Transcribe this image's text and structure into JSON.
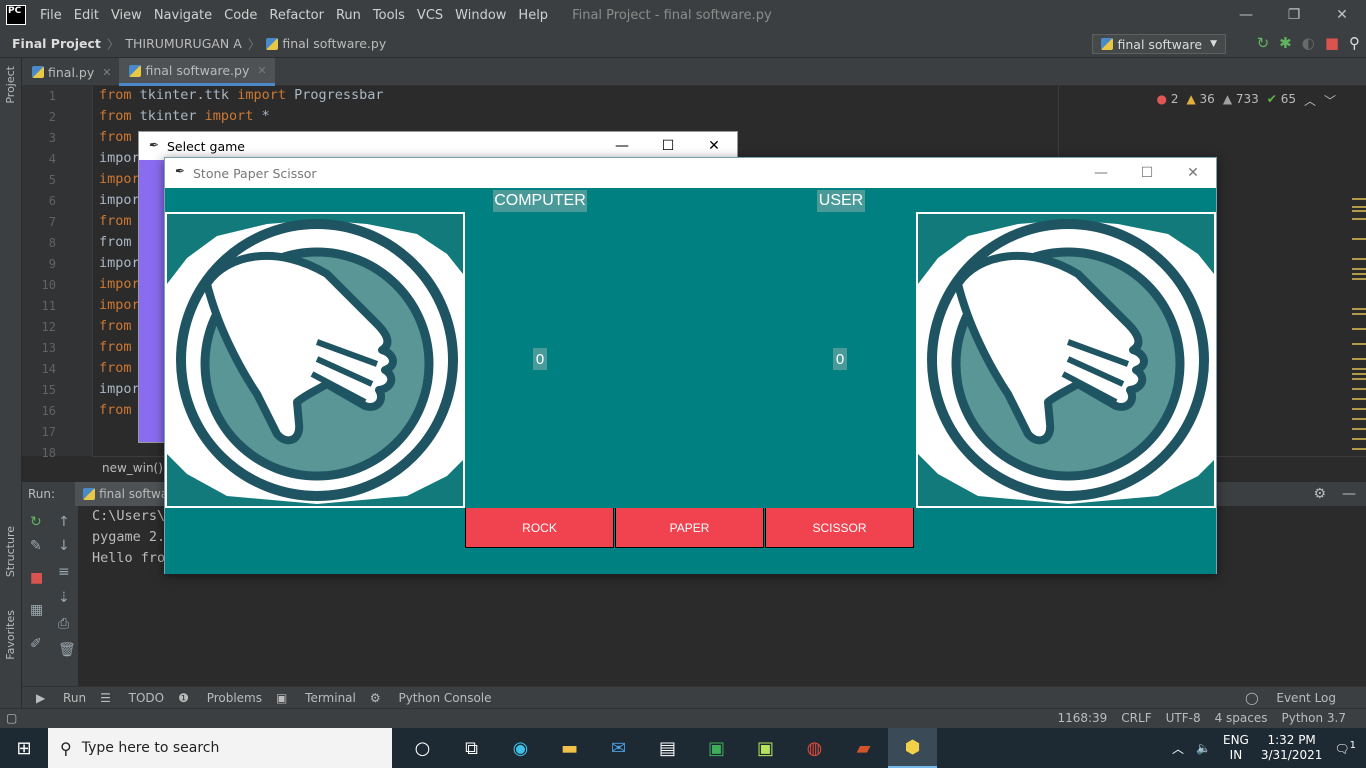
{
  "ide": {
    "logo": "PC",
    "menu": [
      "File",
      "Edit",
      "View",
      "Navigate",
      "Code",
      "Refactor",
      "Run",
      "Tools",
      "VCS",
      "Window",
      "Help"
    ],
    "window_title": "Final Project - final software.py",
    "breadcrumb": [
      "Final Project",
      "THIRUMURUGAN A",
      "final software.py"
    ],
    "run_config": "final software",
    "tabs": [
      {
        "label": "final.py",
        "active": false
      },
      {
        "label": "final software.py",
        "active": true
      }
    ],
    "side_labels": {
      "project": "Project",
      "structure": "Structure",
      "favorites": "Favorites"
    },
    "line_numbers": [
      "1",
      "2",
      "3",
      "4",
      "5",
      "6",
      "7",
      "8",
      "9",
      "10",
      "11",
      "12",
      "13",
      "14",
      "15",
      "16",
      "17",
      "18"
    ],
    "code_lines": [
      {
        "kw": "from",
        "rest": " tkinter.ttk ",
        "kw2": "import",
        "rest2": " Progressbar"
      },
      {
        "kw": "from",
        "rest": " tkinter ",
        "kw2": "import",
        "rest2": " *"
      },
      {
        "kw": "from",
        "rest": "",
        "kw2": "",
        "rest2": ""
      },
      {
        "kw": "",
        "rest": "impor",
        "kw2": "",
        "rest2": ""
      },
      {
        "kw": "impor",
        "rest": "",
        "kw2": "",
        "rest2": ""
      },
      {
        "kw": "",
        "rest": "impor",
        "kw2": "",
        "rest2": ""
      },
      {
        "kw": "from",
        "rest": "",
        "kw2": "",
        "rest2": ""
      },
      {
        "kw": "",
        "rest": "from",
        "kw2": "",
        "rest2": ""
      },
      {
        "kw": "",
        "rest": "impor",
        "kw2": "",
        "rest2": ""
      },
      {
        "kw": "impor",
        "rest": "",
        "kw2": "",
        "rest2": ""
      },
      {
        "kw": "impor",
        "rest": "",
        "kw2": "",
        "rest2": ""
      },
      {
        "kw": "from",
        "rest": "",
        "kw2": "",
        "rest2": ""
      },
      {
        "kw": "from",
        "rest": "",
        "kw2": "",
        "rest2": ""
      },
      {
        "kw": "from",
        "rest": "",
        "kw2": "",
        "rest2": ""
      },
      {
        "kw": "",
        "rest": "impor",
        "kw2": "",
        "rest2": ""
      },
      {
        "kw": "from",
        "rest": "",
        "kw2": "",
        "rest2": ""
      }
    ],
    "inspections": {
      "errors": "2",
      "warnings": "36",
      "weak_warnings": "733",
      "typos": "65"
    },
    "editor_breadcrumb": "new_win()",
    "run_label": "Run:",
    "run_tab": "final software",
    "console_lines": [
      "C:\\Users\\",
      "pygame 2.",
      "Hello fro"
    ],
    "bottom_tools": [
      "Run",
      "TODO",
      "Problems",
      "Terminal",
      "Python Console"
    ],
    "event_log": "Event Log",
    "status": {
      "position": "1168:39",
      "line_sep": "CRLF",
      "encoding": "UTF-8",
      "indent": "4 spaces",
      "interpreter": "Python 3.7"
    }
  },
  "select_window": {
    "title": "Select game"
  },
  "game_window": {
    "title": "Stone Paper Scissor",
    "computer_label": "COMPUTER",
    "user_label": "USER",
    "computer_score": "0",
    "user_score": "0",
    "buttons": {
      "rock": "ROCK",
      "paper": "PAPER",
      "scissor": "SCISSOR"
    },
    "colors": {
      "background": "#008080",
      "button": "#f0424f",
      "label_bg": "#4a9a9a",
      "hand_ring": "#1f5562",
      "hand_fill": "#5a9696"
    }
  },
  "taskbar": {
    "search_placeholder": "Type here to search",
    "language": "ENG",
    "region": "IN",
    "time": "1:32 PM",
    "date": "3/31/2021",
    "notification_count": "1"
  }
}
